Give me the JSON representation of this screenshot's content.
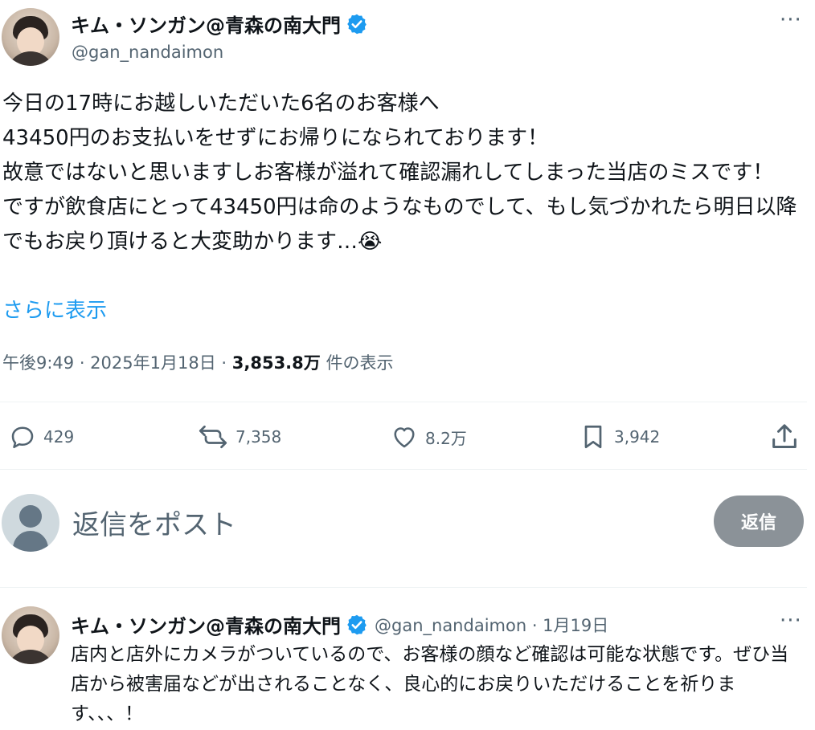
{
  "tweet": {
    "author_name": "キム・ソンガン@青森の南大門",
    "author_handle": "@gan_nandaimon",
    "more_label": "···",
    "lines": [
      "今日の17時にお越しいただいた6名のお客様へ",
      "43450円のお支払いをせずにお帰りになられております！",
      "故意ではないと思いますしお客様が溢れて確認漏れしてしまった当店のミスです！",
      "ですが飲食店にとって43450円は命のようなものでして、もし気づかれたら明日以降でもお戻り頂けると大変助かります…😭"
    ],
    "show_more": "さらに表示",
    "timestamp": "午後9:49 · 2025年1月18日 · ",
    "views_count": "3,853.8万",
    "views_label": " 件の表示"
  },
  "actions": {
    "replies": "429",
    "reposts": "7,358",
    "likes": "8.2万",
    "bookmarks": "3,942"
  },
  "composer": {
    "placeholder": "返信をポスト",
    "button": "返信"
  },
  "reply": {
    "author_name": "キム・ソンガン@青森の南大門",
    "handle_date": "@gan_nandaimon · 1月19日",
    "more_label": "···",
    "text": "店内と店外にカメラがついているので、お客様の顔など確認は可能な状態です。ぜひ当店から被害届などが出されることなく、良心的にお戻りいただけることを祈ります、、、！"
  },
  "colors": {
    "accent": "#1d9bf0",
    "muted": "#536471",
    "reply_button": "#8b9298"
  }
}
